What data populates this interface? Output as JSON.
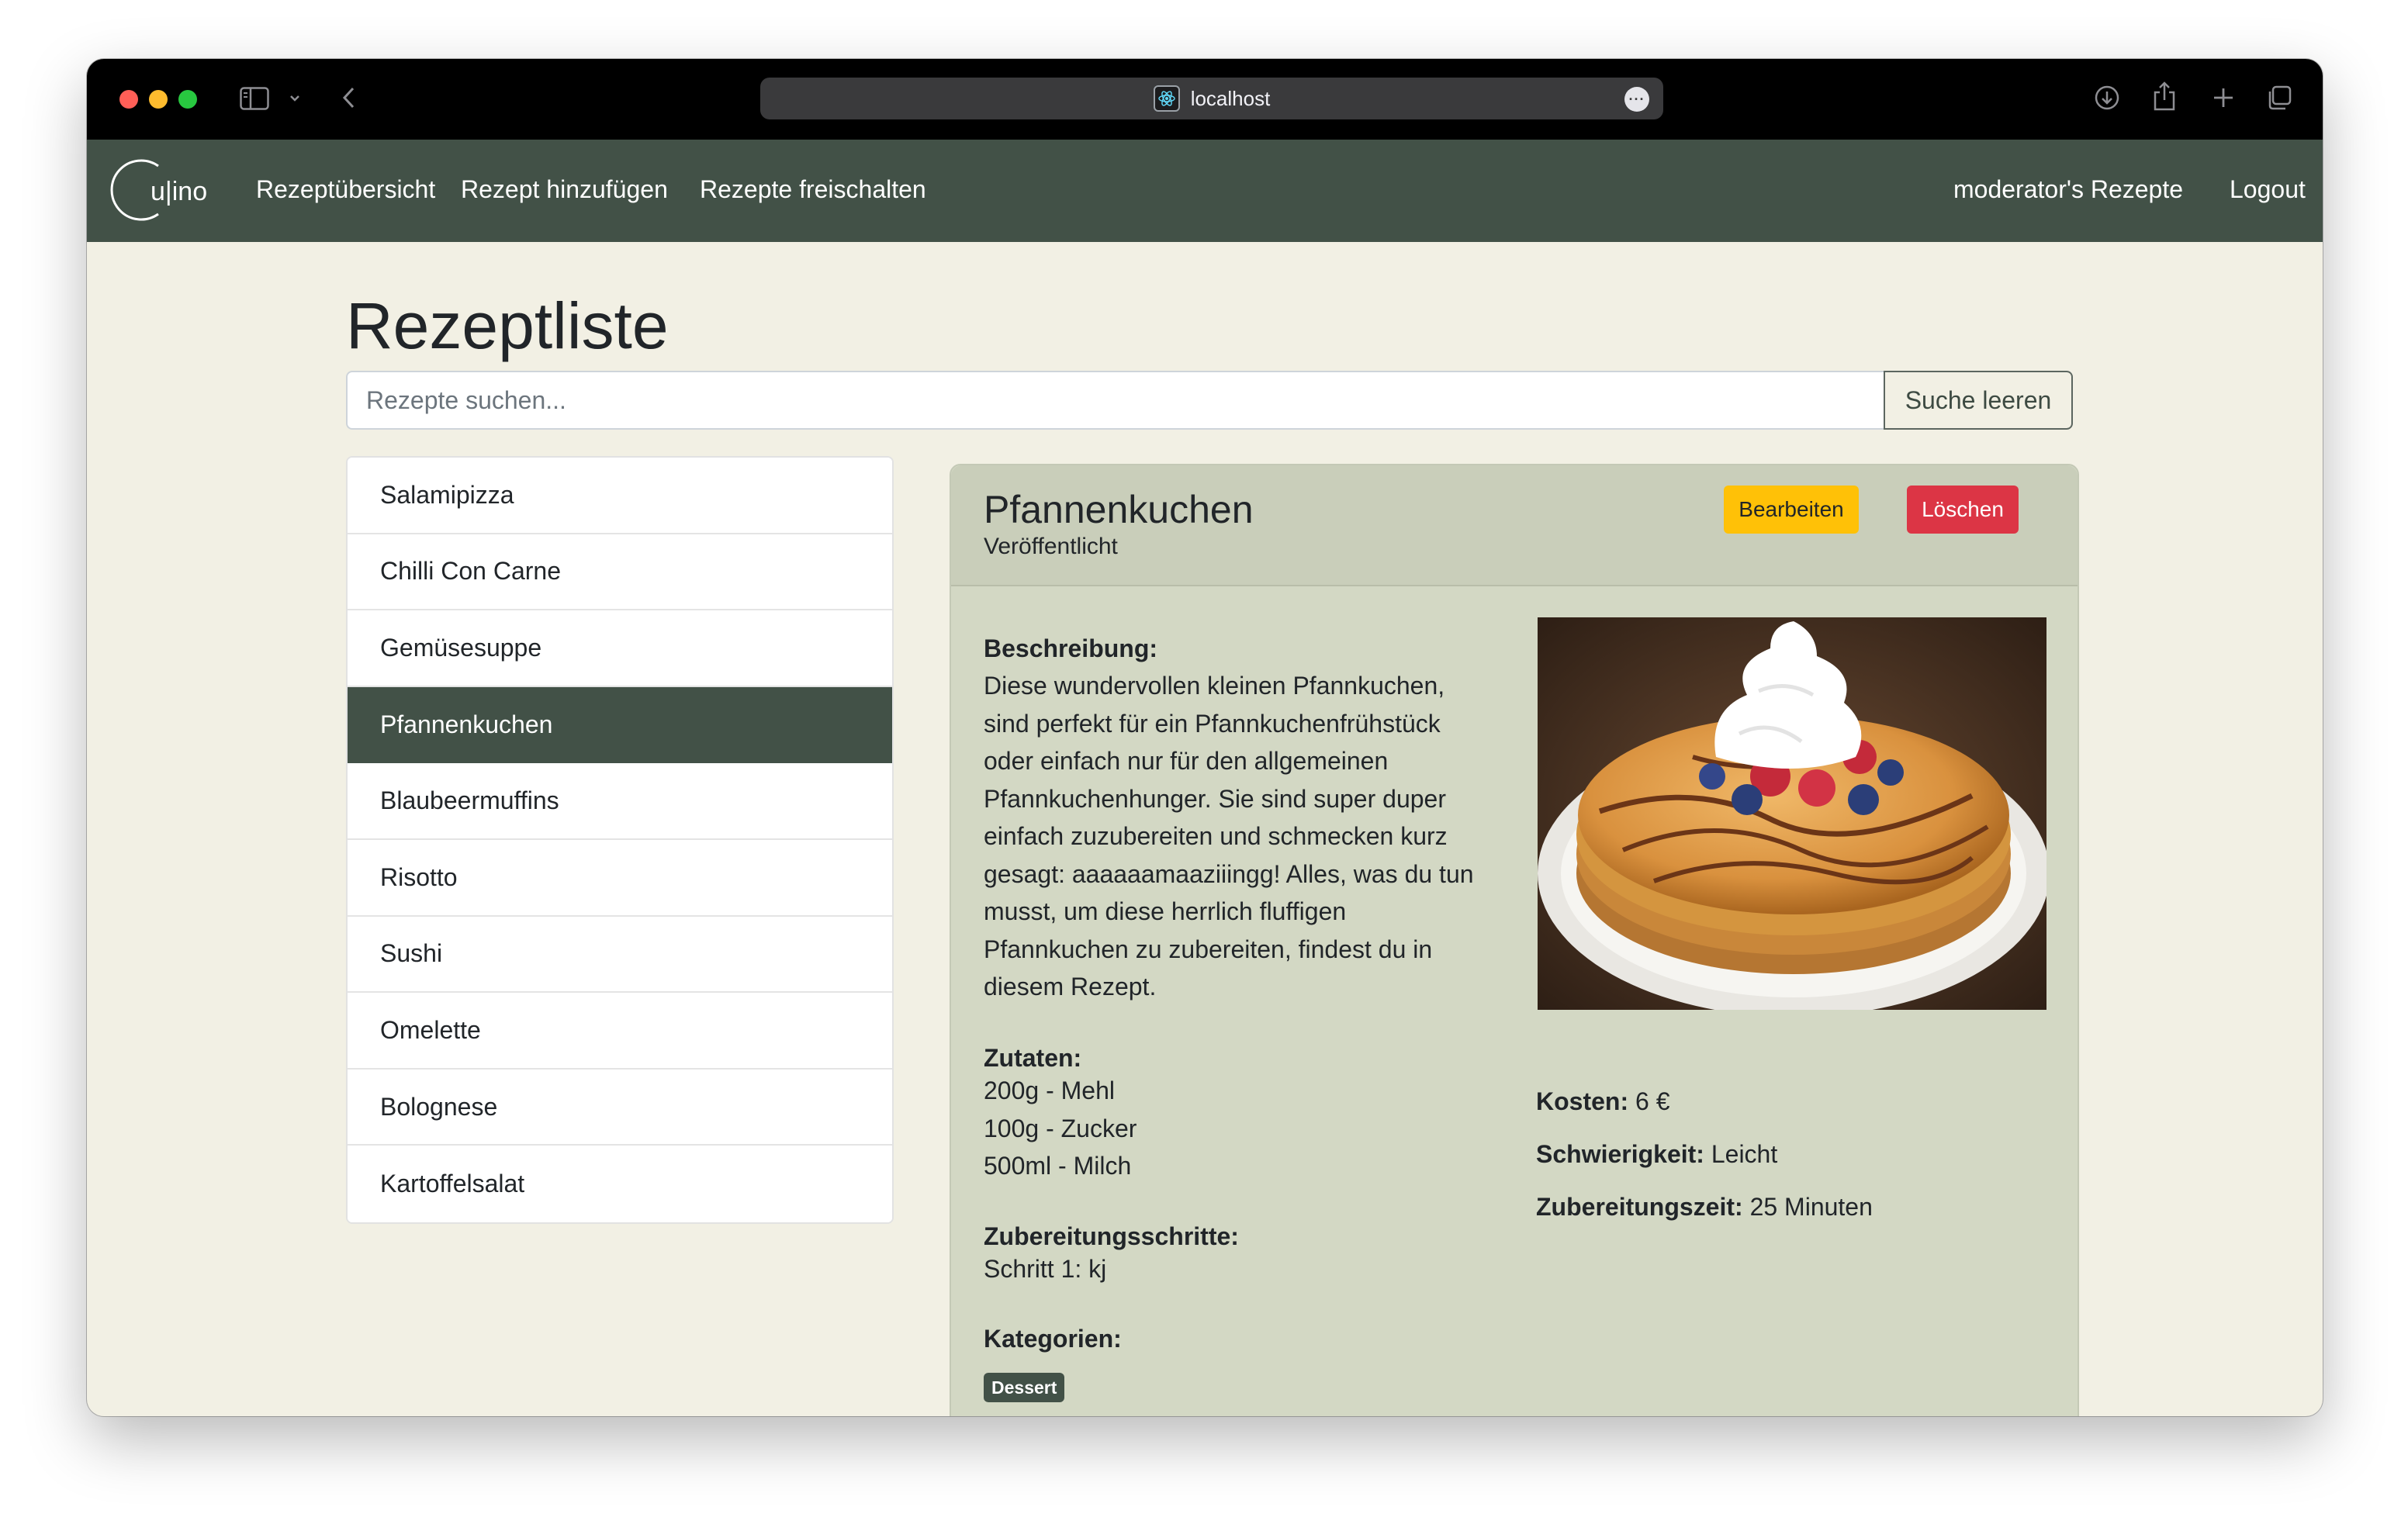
{
  "browser": {
    "url": "localhost"
  },
  "navbar": {
    "brand_text": "u|ino",
    "links": {
      "overview": "Rezeptübersicht",
      "add": "Rezept hinzufügen",
      "unlock": "Rezepte freischalten",
      "mine": "moderator's Rezepte",
      "logout": "Logout"
    }
  },
  "page": {
    "title": "Rezeptliste",
    "search_placeholder": "Rezepte suchen...",
    "search_value": "",
    "clear_button": "Suche leeren"
  },
  "recipes": [
    {
      "name": "Salamipizza",
      "active": false
    },
    {
      "name": "Chilli Con Carne",
      "active": false
    },
    {
      "name": "Gemüsesuppe",
      "active": false
    },
    {
      "name": "Pfannenkuchen",
      "active": true
    },
    {
      "name": "Blaubeermuffins",
      "active": false
    },
    {
      "name": "Risotto",
      "active": false
    },
    {
      "name": "Sushi",
      "active": false
    },
    {
      "name": "Omelette",
      "active": false
    },
    {
      "name": "Bolognese",
      "active": false
    },
    {
      "name": "Kartoffelsalat",
      "active": false
    }
  ],
  "detail": {
    "title": "Pfannenkuchen",
    "status": "Veröffentlicht",
    "edit_button": "Bearbeiten",
    "delete_button": "Löschen",
    "description_label": "Beschreibung:",
    "description_lines": [
      "Diese wundervollen kleinen Pfannkuchen,",
      "sind perfekt für ein Pfannkuchenfrühstück",
      "oder einfach nur für den allgemeinen",
      "Pfannkuchenhunger. Sie sind super duper",
      "einfach zuzubereiten und schmecken kurz",
      "gesagt: aaaaaamaaziiingg! Alles, was du tun",
      "musst, um diese herrlich fluffigen",
      "Pfannkuchen zu zubereiten, findest du in",
      "diesem Rezept."
    ],
    "ingredients_label": "Zutaten:",
    "ingredients": [
      "200g - Mehl",
      "100g - Zucker",
      "500ml - Milch"
    ],
    "steps_label": "Zubereitungsschritte:",
    "steps": [
      "Schritt 1: kj"
    ],
    "categories_label": "Kategorien:",
    "categories": [
      "Dessert"
    ],
    "cost_label": "Kosten:",
    "cost_value": "6 €",
    "difficulty_label": "Schwierigkeit:",
    "difficulty_value": "Leicht",
    "time_label": "Zubereitungszeit:",
    "time_value": "25 Minuten"
  },
  "colors": {
    "navbar": "#425147",
    "page_bg": "#f2f0e4",
    "card_bg": "#d3d8c4",
    "edit": "#ffc107",
    "delete": "#dc3545"
  }
}
